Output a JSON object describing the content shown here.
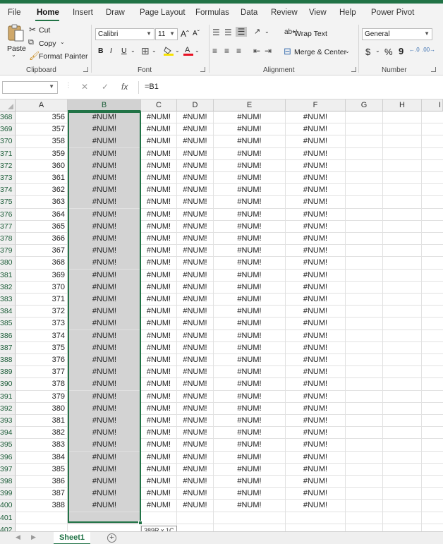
{
  "menu": {
    "tabs": [
      "File",
      "Home",
      "Insert",
      "Draw",
      "Page Layout",
      "Formulas",
      "Data",
      "Review",
      "View",
      "Help",
      "Power Pivot"
    ]
  },
  "ribbon": {
    "clipboard": {
      "paste": "Paste",
      "cut": "Cut",
      "copy": "Copy",
      "format_painter": "Format Painter",
      "label": "Clipboard"
    },
    "font": {
      "name": "Calibri",
      "size": "11",
      "bold": "B",
      "italic": "I",
      "underline": "U",
      "grow": "Aˆ",
      "shrink": "Aˇ",
      "label": "Font"
    },
    "alignment": {
      "wrap_text": "Wrap Text",
      "merge_center": "Merge & Center",
      "label": "Alignment"
    },
    "number": {
      "format": "General",
      "currency": "$",
      "percent": "%",
      "comma": "9",
      "inc_dec": ".00",
      "label": "Number"
    }
  },
  "formula_bar": {
    "name_box": "",
    "fx": "fx",
    "cancel": "✕",
    "enter": "✓",
    "formula": "=B1"
  },
  "columns": [
    "A",
    "B",
    "C",
    "D",
    "E",
    "F",
    "G",
    "H",
    "I"
  ],
  "error": "#NUM!",
  "rows": [
    {
      "r": "368",
      "a": "356"
    },
    {
      "r": "369",
      "a": "357"
    },
    {
      "r": "370",
      "a": "358"
    },
    {
      "r": "371",
      "a": "359"
    },
    {
      "r": "372",
      "a": "360"
    },
    {
      "r": "373",
      "a": "361"
    },
    {
      "r": "374",
      "a": "362"
    },
    {
      "r": "375",
      "a": "363"
    },
    {
      "r": "376",
      "a": "364"
    },
    {
      "r": "377",
      "a": "365"
    },
    {
      "r": "378",
      "a": "366"
    },
    {
      "r": "379",
      "a": "367"
    },
    {
      "r": "380",
      "a": "368"
    },
    {
      "r": "381",
      "a": "369"
    },
    {
      "r": "382",
      "a": "370"
    },
    {
      "r": "383",
      "a": "371"
    },
    {
      "r": "384",
      "a": "372"
    },
    {
      "r": "385",
      "a": "373"
    },
    {
      "r": "386",
      "a": "374"
    },
    {
      "r": "387",
      "a": "375"
    },
    {
      "r": "388",
      "a": "376"
    },
    {
      "r": "389",
      "a": "377"
    },
    {
      "r": "390",
      "a": "378"
    },
    {
      "r": "391",
      "a": "379"
    },
    {
      "r": "392",
      "a": "380"
    },
    {
      "r": "393",
      "a": "381"
    },
    {
      "r": "394",
      "a": "382"
    },
    {
      "r": "395",
      "a": "383"
    },
    {
      "r": "396",
      "a": "384"
    },
    {
      "r": "397",
      "a": "385"
    },
    {
      "r": "398",
      "a": "386"
    },
    {
      "r": "399",
      "a": "387"
    },
    {
      "r": "400",
      "a": "388"
    }
  ],
  "empty_rows": [
    "401",
    "402"
  ],
  "selection_tooltip": "389R x 1C",
  "sheets": {
    "active": "Sheet1",
    "add": "+"
  },
  "colors": {
    "accent": "#217346",
    "selection": "#d3d3d3"
  }
}
